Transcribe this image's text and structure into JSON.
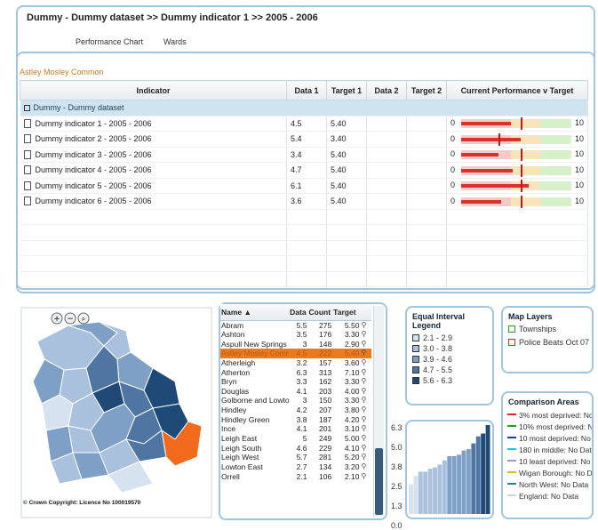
{
  "header": {
    "title": "Dummy - Dummy dataset >> Dummy indicator 1 >> 2005 - 2006"
  },
  "tabs": [
    "Performance Chart",
    "Wards"
  ],
  "area_name": "Astley Mosley Common",
  "table": {
    "columns": [
      "Indicator",
      "Data 1",
      "Target 1",
      "Data 2",
      "Target 2",
      "Current Performance v Target"
    ],
    "group": "Dummy - Dummy dataset",
    "rows": [
      {
        "name": "Dummy indicator 1 - 2005 - 2006",
        "data1": "4.5",
        "target1": "5.40",
        "data2": "",
        "target2": ""
      },
      {
        "name": "Dummy indicator 2 - 2005 - 2006",
        "data1": "5.4",
        "target1": "3.40",
        "data2": "",
        "target2": ""
      },
      {
        "name": "Dummy indicator 3 - 2005 - 2006",
        "data1": "3.4",
        "target1": "5.40",
        "data2": "",
        "target2": ""
      },
      {
        "name": "Dummy indicator 4 - 2005 - 2006",
        "data1": "4.7",
        "target1": "5.40",
        "data2": "",
        "target2": ""
      },
      {
        "name": "Dummy indicator 5 - 2005 - 2006",
        "data1": "6.1",
        "target1": "5.40",
        "data2": "",
        "target2": ""
      },
      {
        "name": "Dummy indicator 6 - 2005 - 2006",
        "data1": "3.6",
        "target1": "5.40",
        "data2": "",
        "target2": ""
      }
    ],
    "perf_min": "0",
    "perf_max": "10"
  },
  "map": {
    "copyright": "© Crown Copyright: Licence No 100019570",
    "highlight_color": "#f26a1b"
  },
  "wards": {
    "columns": [
      "Name ▲",
      "Data",
      "Count",
      "Target"
    ],
    "rows": [
      [
        "Abram",
        "5.5",
        "275",
        "5.50"
      ],
      [
        "Ashton",
        "3.5",
        "176",
        "3.30"
      ],
      [
        "Aspull New Springs",
        "3",
        "148",
        "2.90"
      ],
      [
        "Astley Mosley Common",
        "4.5",
        "222",
        "5.40"
      ],
      [
        "Atherleigh",
        "3.2",
        "157",
        "3.60"
      ],
      [
        "Atherton",
        "6.3",
        "313",
        "7.10"
      ],
      [
        "Bryn",
        "3.3",
        "162",
        "3.30"
      ],
      [
        "Douglas",
        "4.1",
        "203",
        "4.00"
      ],
      [
        "Golborne and Lowton West",
        "3",
        "150",
        "3.30"
      ],
      [
        "Hindley",
        "4.2",
        "207",
        "3.80"
      ],
      [
        "Hindley Green",
        "3.8",
        "187",
        "4.20"
      ],
      [
        "Ince",
        "4.1",
        "201",
        "3.10"
      ],
      [
        "Leigh East",
        "5",
        "249",
        "5.00"
      ],
      [
        "Leigh South",
        "4.6",
        "229",
        "4.10"
      ],
      [
        "Leigh West",
        "5.7",
        "281",
        "5.20"
      ],
      [
        "Lowton East",
        "2.7",
        "134",
        "3.20"
      ],
      [
        "Orrell",
        "2.1",
        "106",
        "2.10"
      ]
    ],
    "selected_index": 3
  },
  "legend": {
    "title": "Equal Interval Legend",
    "items": [
      {
        "label": "2.1 - 2.9",
        "color": "#d6e2ef"
      },
      {
        "label": "3.0 - 3.8",
        "color": "#a9c1dc"
      },
      {
        "label": "3.9 - 4.6",
        "color": "#7e9fc6"
      },
      {
        "label": "4.7 - 5.5",
        "color": "#4f76a3"
      },
      {
        "label": "5.6 - 6.3",
        "color": "#1f4a78"
      }
    ]
  },
  "histogram": {
    "ticks": [
      "6.3",
      "5.0",
      "3.8",
      "2.5",
      "1.3",
      "0.0"
    ]
  },
  "layers": {
    "title": "Map Layers",
    "items": [
      "Townships",
      "Police Beats Oct 07"
    ]
  },
  "comparison": {
    "title": "Comparison Areas",
    "items": [
      {
        "label": "3% most deprived: No Data",
        "color": "#d62b2b"
      },
      {
        "label": "10% most deprived: No Data",
        "color": "#2a9a2a"
      },
      {
        "label": "10 most deprived: No Data",
        "color": "#1f3fa0"
      },
      {
        "label": "180 in middle: No Data",
        "color": "#29c3e0"
      },
      {
        "label": "10 least deprived: No Data",
        "color": "#9a9ad6"
      },
      {
        "label": "Wigan Borough: No Data",
        "color": "#e0b22a"
      },
      {
        "label": "North West: No Data",
        "color": "#2e7d8c"
      },
      {
        "label": "England: No Data",
        "color": "#c9d7e8"
      }
    ]
  },
  "colors": {
    "panel_border": "#9fc6de",
    "accent_orange": "#ea7a1c"
  }
}
